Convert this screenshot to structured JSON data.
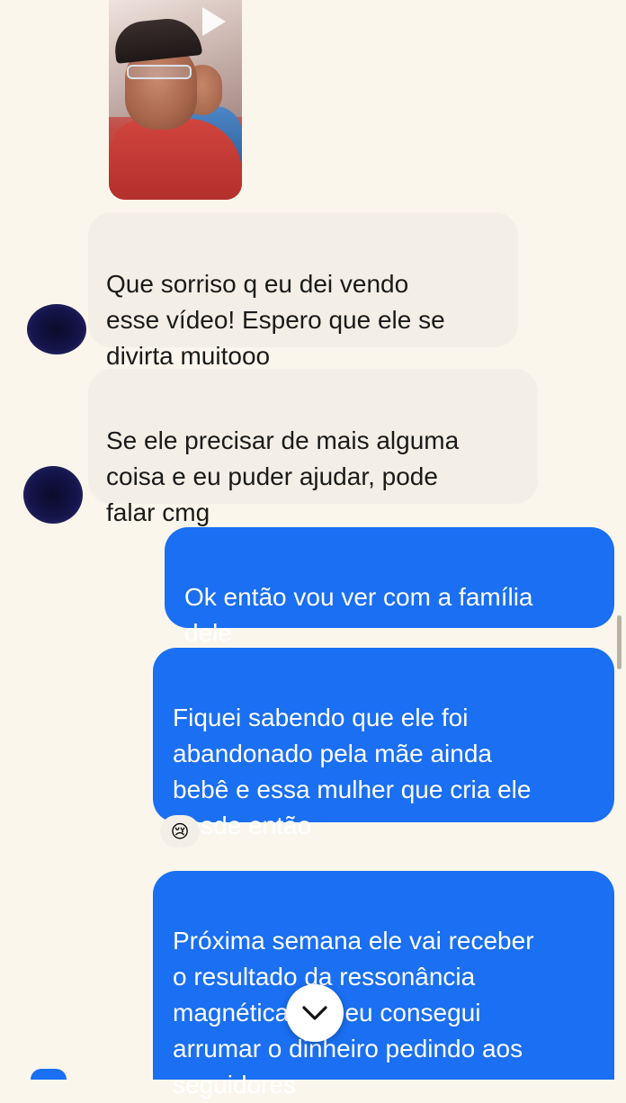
{
  "conversation": {
    "video": {
      "play_icon": "play-icon"
    },
    "messages": [
      {
        "side": "incoming",
        "text": "Que sorriso q eu dei vendo\nesse vídeo! Espero que ele se\ndivirta muitooo"
      },
      {
        "side": "incoming",
        "text": "Se ele precisar de mais alguma\ncoisa e eu puder ajudar, pode\nfalar cmg"
      },
      {
        "side": "outgoing",
        "text": "Ok então vou ver com a família\ndele"
      },
      {
        "side": "outgoing",
        "text": "Fiquei sabendo que ele foi\nabandonado pela mãe ainda\nbebê e essa mulher que cria ele\ndesde então",
        "reaction": "😢"
      },
      {
        "side": "outgoing",
        "text": "Próxima semana ele vai receber\no resultado da ressonância\nmagnética que eu consegui\narrumar o dinheiro pedindo aos\nseguidores"
      }
    ]
  },
  "colors": {
    "outgoing_bubble": "#1a6ff2",
    "incoming_bubble": "#f3efe6",
    "background": "#fbf6ec"
  },
  "controls": {
    "scroll_down_icon": "chevron-down-icon"
  }
}
